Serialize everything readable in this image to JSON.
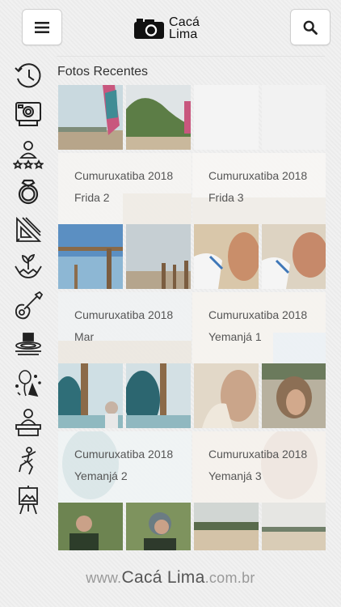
{
  "header": {
    "menu_icon": "hamburger-icon",
    "search_icon": "search-icon",
    "logo_icon": "camera-icon",
    "logo_line1": "Cacá",
    "logo_line2": "Lima"
  },
  "sidebar": {
    "items": [
      {
        "icon": "history-icon"
      },
      {
        "icon": "instant-camera-icon"
      },
      {
        "icon": "person-rating-icon"
      },
      {
        "icon": "ring-icon"
      },
      {
        "icon": "drafting-tools-icon"
      },
      {
        "icon": "plant-hands-icon"
      },
      {
        "icon": "guitar-icon"
      },
      {
        "icon": "food-plate-icon"
      },
      {
        "icon": "party-balloons-icon"
      },
      {
        "icon": "teacher-desk-icon"
      },
      {
        "icon": "dancer-icon"
      },
      {
        "icon": "easel-icon"
      }
    ]
  },
  "section": {
    "title": "Fotos Recentes"
  },
  "albums": [
    {
      "line1": "Cumuruxatiba 2018",
      "line2": "Frida 2"
    },
    {
      "line1": "Cumuruxatiba 2018",
      "line2": "Frida 3"
    },
    {
      "line1": "Cumuruxatiba 2018",
      "line2": "Mar"
    },
    {
      "line1": "Cumuruxatiba 2018",
      "line2": "Yemanjá 1"
    },
    {
      "line1": "Cumuruxatiba 2018",
      "line2": "Yemanjá 2"
    },
    {
      "line1": "Cumuruxatiba 2018",
      "line2": "Yemanjá 3"
    }
  ],
  "footer": {
    "prefix": "www.",
    "brand": "Cacá Lima",
    "suffix": ".com.br"
  },
  "colors": {
    "background": "#f1f1f1",
    "text": "#333333",
    "card_overlay": "#ffffff"
  }
}
